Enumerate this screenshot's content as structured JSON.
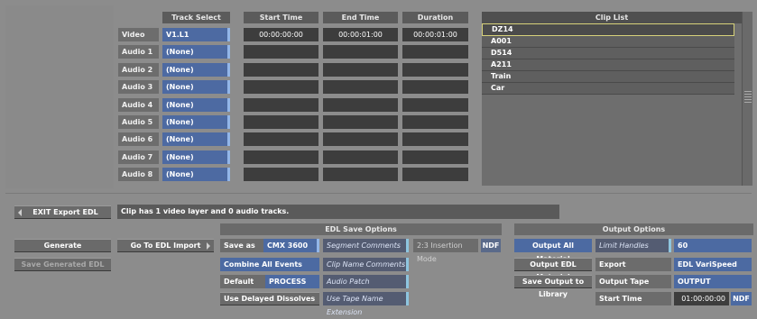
{
  "tracks": {
    "headers": {
      "track_select": "Track Select",
      "start_time": "Start Time",
      "end_time": "End Time",
      "duration": "Duration"
    },
    "rows": [
      {
        "label": "Video Track",
        "select": "V1.L1",
        "start": "00:00:00:00",
        "end": "00:00:01:00",
        "duration": "00:00:01:00"
      },
      {
        "label": "Audio 1",
        "select": "(None)",
        "start": "",
        "end": "",
        "duration": ""
      },
      {
        "label": "Audio 2",
        "select": "(None)",
        "start": "",
        "end": "",
        "duration": ""
      },
      {
        "label": "Audio 3",
        "select": "(None)",
        "start": "",
        "end": "",
        "duration": ""
      },
      {
        "label": "Audio 4",
        "select": "(None)",
        "start": "",
        "end": "",
        "duration": ""
      },
      {
        "label": "Audio 5",
        "select": "(None)",
        "start": "",
        "end": "",
        "duration": ""
      },
      {
        "label": "Audio 6",
        "select": "(None)",
        "start": "",
        "end": "",
        "duration": ""
      },
      {
        "label": "Audio 7",
        "select": "(None)",
        "start": "",
        "end": "",
        "duration": ""
      },
      {
        "label": "Audio 8",
        "select": "(None)",
        "start": "",
        "end": "",
        "duration": ""
      }
    ]
  },
  "clip_list": {
    "title": "Clip List",
    "items": [
      "DZ14",
      "A001",
      "D514",
      "A211",
      "Train",
      "Car"
    ]
  },
  "exit_button": "EXIT Export EDL",
  "status_message": "Clip has 1 video layer and 0 audio tracks.",
  "generate_button": "Generate",
  "save_generated_button": "Save Generated EDL",
  "goto_import_button": "Go To EDL Import",
  "edl_options": {
    "title": "EDL Save Options",
    "save_as_label": "Save as",
    "save_as_value": "CMX 3600",
    "segment_comments": "Segment Comments",
    "insertion_mode": "2:3 Insertion Mode",
    "ndf": "NDF",
    "combine_all_events": "Combine All Events",
    "clip_name_comments": "Clip Name Comments",
    "default_tape_label": "Default Tape",
    "default_tape_value": "PROCESS",
    "audio_patch_comments": "Audio Patch Comments",
    "use_delayed_dissolves": "Use Delayed Dissolves",
    "use_tape_name_extension": "Use Tape Name Extension"
  },
  "output_options": {
    "title": "Output Options",
    "output_all_material": "Output All Material",
    "limit_handles_label": "Limit Handles",
    "limit_handles_value": "60",
    "output_edl_material": "Output EDL Material",
    "export_timewarps_label": "Export Timewarps as",
    "export_timewarps_value": "EDL VariSpeed",
    "save_output_to_library": "Save Output to Library",
    "output_tape_label": "Output Tape",
    "output_tape_value": "OUTPUT",
    "start_time_label": "Start Time",
    "start_time_value": "01:00:00:00",
    "start_time_ndf": "NDF"
  },
  "colors": {
    "background": "#8c8c8c",
    "accent_blue": "#4c6aa2",
    "field_dark": "#3d3d3d",
    "highlight_cyan": "#8ec5df",
    "selection_outline": "#d7d27a"
  }
}
